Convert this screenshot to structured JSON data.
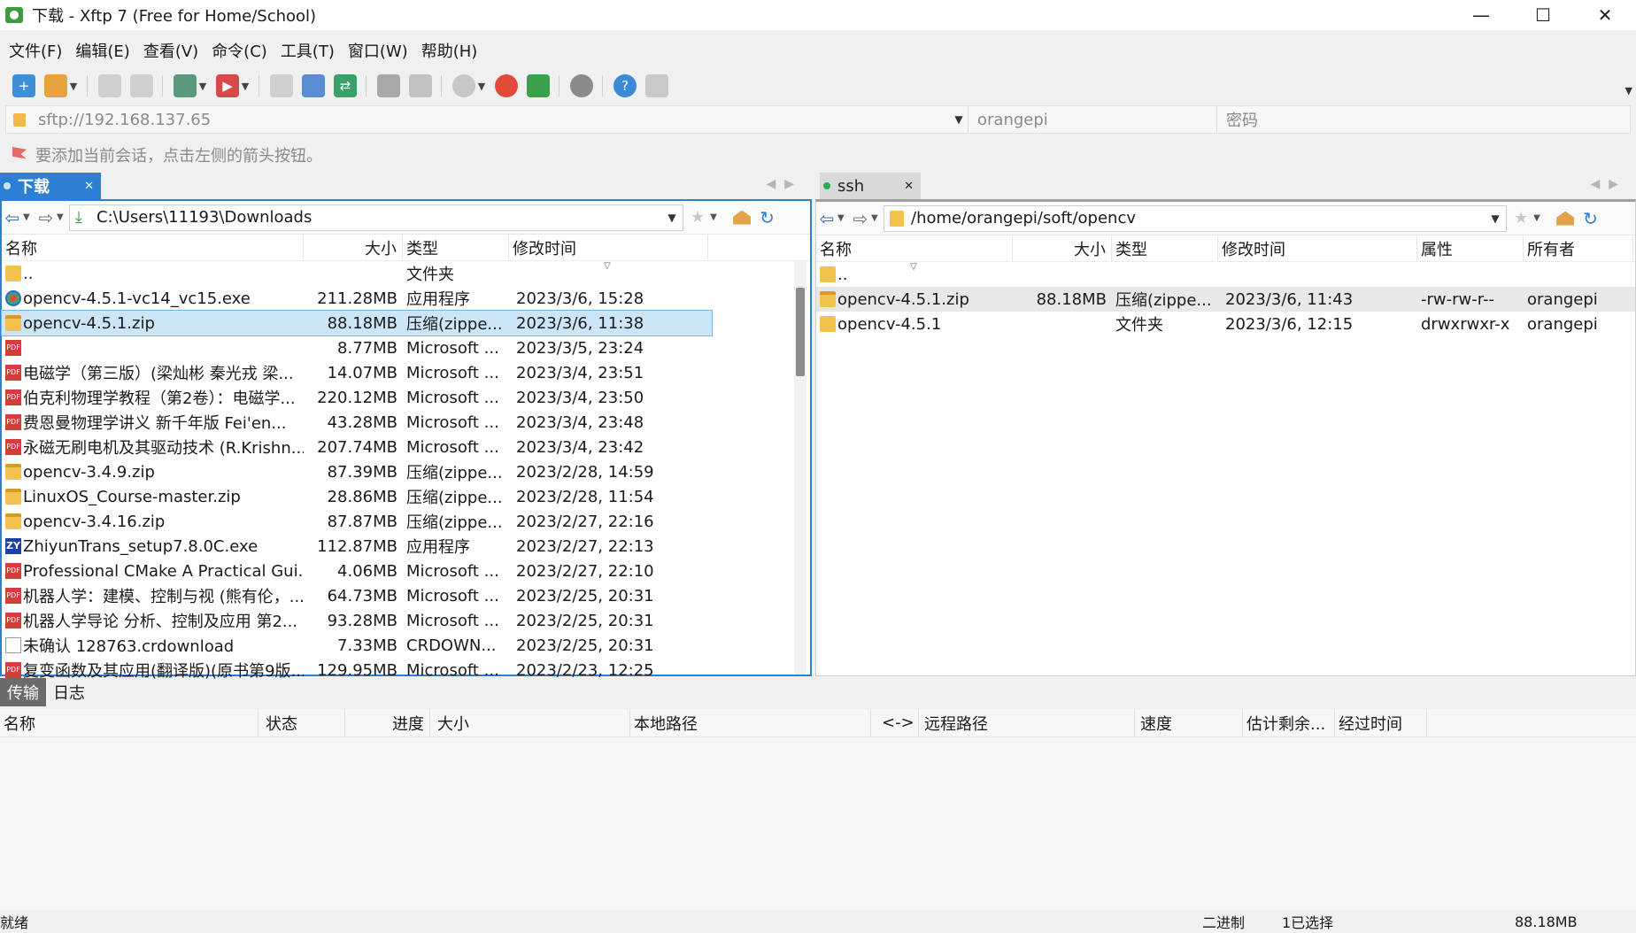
{
  "window": {
    "title": "下载 - Xftp 7 (Free for Home/School)",
    "minimize": "—",
    "maximize": "☐",
    "close": "✕"
  },
  "menu": [
    "文件(F)",
    "编辑(E)",
    "查看(V)",
    "命令(C)",
    "工具(T)",
    "窗口(W)",
    "帮助(H)"
  ],
  "address": {
    "host": "sftp://192.168.137.65",
    "user": "orangepi",
    "password_placeholder": "密码"
  },
  "hint": "要添加当前会话，点击左侧的箭头按钮。",
  "local": {
    "tab_label": "下载",
    "path": "C:\\Users\\11193\\Downloads",
    "columns": [
      "名称",
      "大小",
      "类型",
      "修改时间"
    ],
    "up_row": {
      "name": "..",
      "type": "文件夹"
    },
    "files": [
      {
        "name": "opencv-4.5.1-vc14_vc15.exe",
        "size": "211.28MB",
        "type": "应用程序",
        "modified": "2023/3/6, 15:28",
        "icon": "exe"
      },
      {
        "name": "opencv-4.5.1.zip",
        "size": "88.18MB",
        "type": "压缩(zippe...",
        "modified": "2023/3/6, 11:38",
        "icon": "zip",
        "selected": true
      },
      {
        "name": "",
        "size": "8.77MB",
        "type": "Microsoft ...",
        "modified": "2023/3/5, 23:24",
        "icon": "pdf"
      },
      {
        "name": "电磁学（第三版）(梁灿彬 秦光戎 梁...",
        "size": "14.07MB",
        "type": "Microsoft ...",
        "modified": "2023/3/4, 23:51",
        "icon": "pdf"
      },
      {
        "name": "伯克利物理学教程（第2卷）：电磁学...",
        "size": "220.12MB",
        "type": "Microsoft ...",
        "modified": "2023/3/4, 23:50",
        "icon": "pdf"
      },
      {
        "name": "费恩曼物理学讲义  新千年版   Fei'en...",
        "size": "43.28MB",
        "type": "Microsoft ...",
        "modified": "2023/3/4, 23:48",
        "icon": "pdf"
      },
      {
        "name": "永磁无刷电机及其驱动技术 (R.Krishn...",
        "size": "207.74MB",
        "type": "Microsoft ...",
        "modified": "2023/3/4, 23:42",
        "icon": "pdf"
      },
      {
        "name": "opencv-3.4.9.zip",
        "size": "87.39MB",
        "type": "压缩(zippe...",
        "modified": "2023/2/28, 14:59",
        "icon": "zip"
      },
      {
        "name": "LinuxOS_Course-master.zip",
        "size": "28.86MB",
        "type": "压缩(zippe...",
        "modified": "2023/2/28, 11:54",
        "icon": "zip"
      },
      {
        "name": "opencv-3.4.16.zip",
        "size": "87.87MB",
        "type": "压缩(zippe...",
        "modified": "2023/2/27, 22:16",
        "icon": "zip"
      },
      {
        "name": "ZhiyunTrans_setup7.8.0C.exe",
        "size": "112.87MB",
        "type": "应用程序",
        "modified": "2023/2/27, 22:13",
        "icon": "zy"
      },
      {
        "name": "Professional CMake A Practical Gui...",
        "size": "4.06MB",
        "type": "Microsoft ...",
        "modified": "2023/2/27, 22:10",
        "icon": "pdf"
      },
      {
        "name": "机器人学：建模、控制与视 (熊有伦，...",
        "size": "64.73MB",
        "type": "Microsoft ...",
        "modified": "2023/2/25, 20:31",
        "icon": "pdf"
      },
      {
        "name": "机器人学导论 分析、控制及应用  第2...",
        "size": "93.28MB",
        "type": "Microsoft ...",
        "modified": "2023/2/25, 20:31",
        "icon": "pdf"
      },
      {
        "name": "未确认 128763.crdownload",
        "size": "7.33MB",
        "type": "CRDOWN...",
        "modified": "2023/2/25, 20:31",
        "icon": "file"
      },
      {
        "name": "复变函数及其应用(翻译版)(原书第9版...",
        "size": "129.95MB",
        "type": "Microsoft ...",
        "modified": "2023/2/23, 12:25",
        "icon": "pdf"
      }
    ]
  },
  "remote": {
    "tab_label": "ssh",
    "path": "/home/orangepi/soft/opencv",
    "columns": [
      "名称",
      "大小",
      "类型",
      "修改时间",
      "属性",
      "所有者"
    ],
    "up_row": {
      "name": ".."
    },
    "files": [
      {
        "name": "opencv-4.5.1.zip",
        "size": "88.18MB",
        "type": "压缩(zippe...",
        "modified": "2023/3/6, 11:43",
        "attr": "-rw-rw-r--",
        "owner": "orangepi",
        "icon": "zip",
        "selected": true
      },
      {
        "name": "opencv-4.5.1",
        "size": "",
        "type": "文件夹",
        "modified": "2023/3/6, 12:15",
        "attr": "drwxrwxr-x",
        "owner": "orangepi",
        "icon": "folder"
      }
    ]
  },
  "transfer": {
    "tabs": [
      "传输",
      "日志"
    ],
    "columns": [
      "名称",
      "状态",
      "进度",
      "大小",
      "本地路径",
      "<->",
      "远程路径",
      "速度",
      "估计剩余...",
      "经过时间"
    ]
  },
  "status": {
    "ready": "就绪",
    "mode": "二进制",
    "selection": "1已选择",
    "size": "88.18MB"
  },
  "colors": {
    "accent": "#2c7fd2",
    "selection": "#cde6f7"
  }
}
